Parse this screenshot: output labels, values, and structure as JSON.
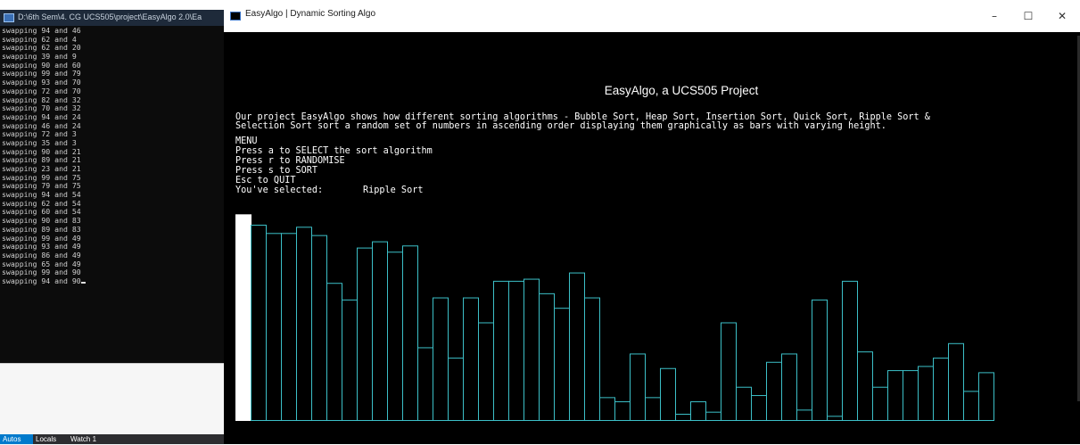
{
  "console": {
    "title": "D:\\6th Sem\\4. CG UCS505\\project\\EasyAlgo 2.0\\Ea",
    "lines": [
      "swapping 94 and 46",
      "swapping 62 and 4",
      "swapping 62 and 20",
      "swapping 39 and 9",
      "swapping 90 and 60",
      "swapping 99 and 79",
      "swapping 93 and 70",
      "swapping 72 and 70",
      "swapping 82 and 32",
      "swapping 70 and 32",
      "swapping 94 and 24",
      "swapping 46 and 24",
      "swapping 72 and 3",
      "swapping 35 and 3",
      "swapping 90 and 21",
      "swapping 89 and 21",
      "swapping 23 and 21",
      "swapping 99 and 75",
      "swapping 79 and 75",
      "swapping 94 and 54",
      "swapping 62 and 54",
      "swapping 60 and 54",
      "swapping 90 and 83",
      "swapping 89 and 83",
      "swapping 99 and 49",
      "swapping 93 and 49",
      "swapping 86 and 49",
      "swapping 65 and 49",
      "swapping 99 and 90",
      "swapping 94 and 90"
    ]
  },
  "debug_tabs": [
    "Autos",
    "Locals",
    "Watch 1"
  ],
  "app": {
    "title": "EasyAlgo | Dynamic Sorting Algo",
    "window_controls": {
      "minimize": "–",
      "maximize": "☐",
      "close": "✕"
    },
    "heading": "EasyAlgo, a UCS505 Project",
    "description_line1": "Our project EasyAlgo shows how different sorting algorithms - Bubble Sort, Heap Sort, Insertion Sort, Quick Sort, Ripple Sort &",
    "description_line2": "Selection Sort sort a random set of numbers in ascending order displaying them graphically as bars with varying height.",
    "menu": {
      "title": "MENU",
      "items": [
        "Press a to SELECT the sort algorithm",
        "Press r to RANDOMISE",
        "Press s to SORT",
        "Esc to QUIT"
      ],
      "selected_prefix": "You've selected:",
      "selected_value": "Ripple Sort"
    }
  },
  "chart_data": {
    "type": "bar",
    "values": [
      99,
      94,
      90,
      90,
      93,
      89,
      66,
      58,
      83,
      86,
      81,
      84,
      35,
      59,
      30,
      59,
      47,
      67,
      67,
      68,
      61,
      54,
      71,
      59,
      11,
      9,
      32,
      11,
      25,
      3,
      9,
      4,
      47,
      16,
      12,
      28,
      32,
      5,
      58,
      2,
      67,
      33,
      16,
      24,
      24,
      26,
      30,
      37,
      14,
      23
    ],
    "highlighted_index": 0,
    "colors": {
      "bar_outline": "#3cc0c8",
      "highlight_fill": "#ffffff",
      "background": "#000000"
    }
  }
}
